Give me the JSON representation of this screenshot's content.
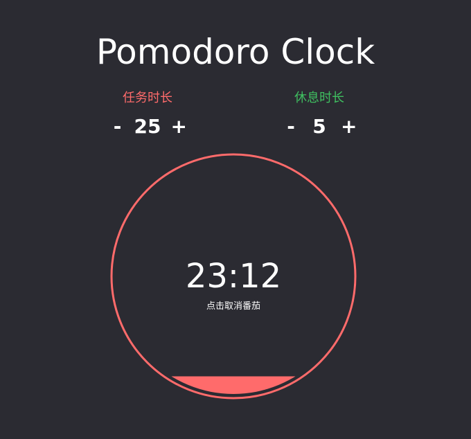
{
  "app": {
    "title": "Pomodoro Clock"
  },
  "task": {
    "label": "任务时长",
    "minus": "-",
    "value": "25",
    "plus": "+"
  },
  "break": {
    "label": "休息时长",
    "minus": "-",
    "value": "5",
    "plus": "+"
  },
  "clock": {
    "time": "23:12",
    "hint": "点击取消番茄",
    "progress": 0.075
  },
  "colors": {
    "background": "#2b2b32",
    "task": "#ff6b6b",
    "break": "#3fbf60",
    "text": "#ffffff"
  }
}
